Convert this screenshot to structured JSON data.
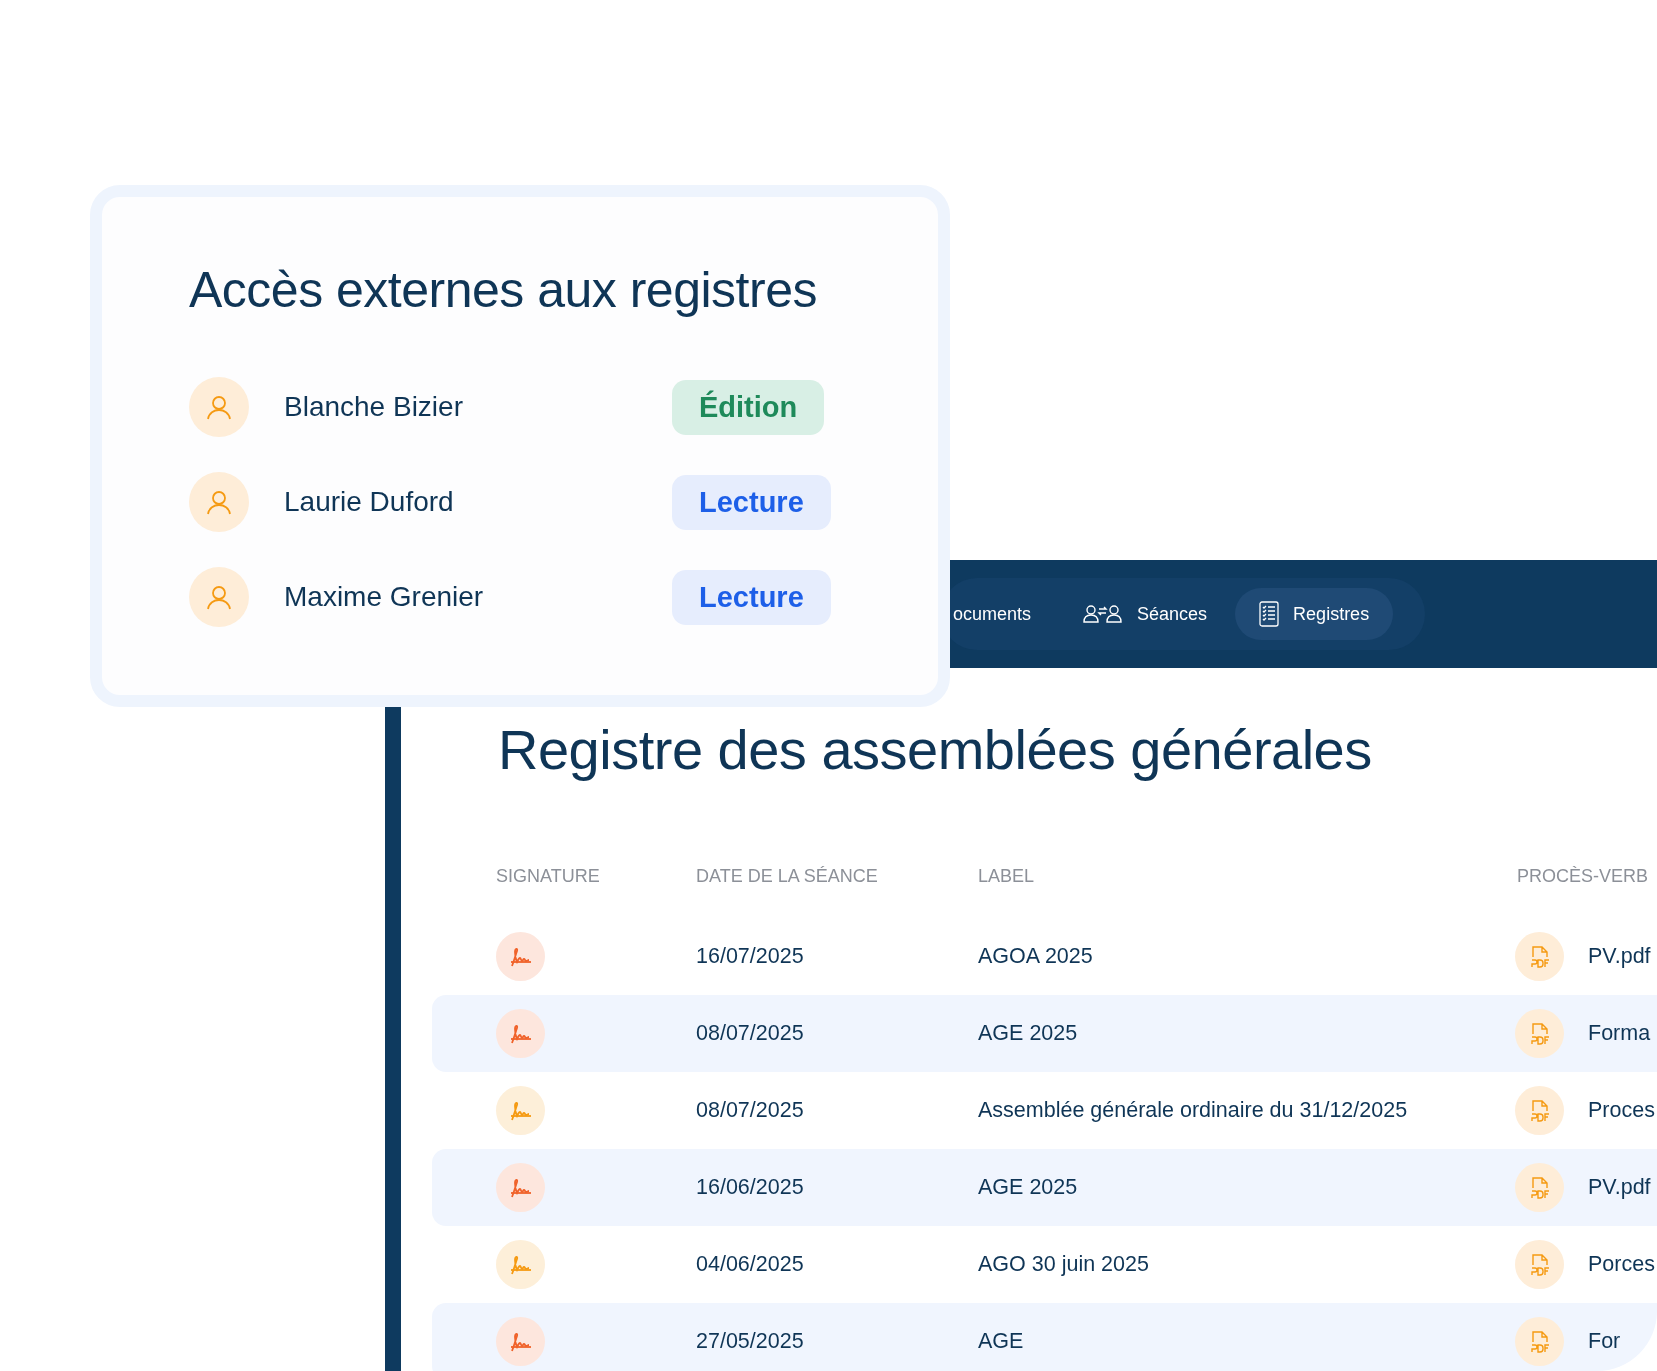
{
  "access_card": {
    "title": "Accès externes aux registres",
    "users": [
      {
        "name": "Blanche Bizier",
        "role": "Édition",
        "kind": "edit"
      },
      {
        "name": "Laurie Duford",
        "role": "Lecture",
        "kind": "read"
      },
      {
        "name": "Maxime Grenier",
        "role": "Lecture",
        "kind": "read"
      }
    ]
  },
  "nav": {
    "tabs": [
      {
        "label": "ocuments",
        "kind": "plain",
        "selected": false
      },
      {
        "label": "Séances",
        "kind": "people",
        "selected": false
      },
      {
        "label": "Registres",
        "kind": "list",
        "selected": true
      }
    ]
  },
  "register": {
    "title": "Registre des assemblées générales",
    "columns": [
      "SIGNATURE",
      "DATE DE LA SÉANCE",
      "LABEL",
      "PROCÈS-VERB"
    ],
    "rows": [
      {
        "color": "#f0622a",
        "date": "16/07/2025",
        "label": "AGOA 2025",
        "file": "PV.pdf"
      },
      {
        "color": "#f0622a",
        "date": "08/07/2025",
        "label": "AGE 2025",
        "file": "Forma"
      },
      {
        "color": "#f59a12",
        "date": "08/07/2025",
        "label": "Assemblée générale ordinaire du 31/12/2025",
        "file": "Proces"
      },
      {
        "color": "#f0622a",
        "date": "16/06/2025",
        "label": "AGE 2025",
        "file": "PV.pdf"
      },
      {
        "color": "#f59a12",
        "date": "04/06/2025",
        "label": "AGO 30 juin 2025",
        "file": "Porces"
      },
      {
        "color": "#f0622a",
        "date": "27/05/2025",
        "label": "AGE",
        "file": "For"
      }
    ]
  }
}
